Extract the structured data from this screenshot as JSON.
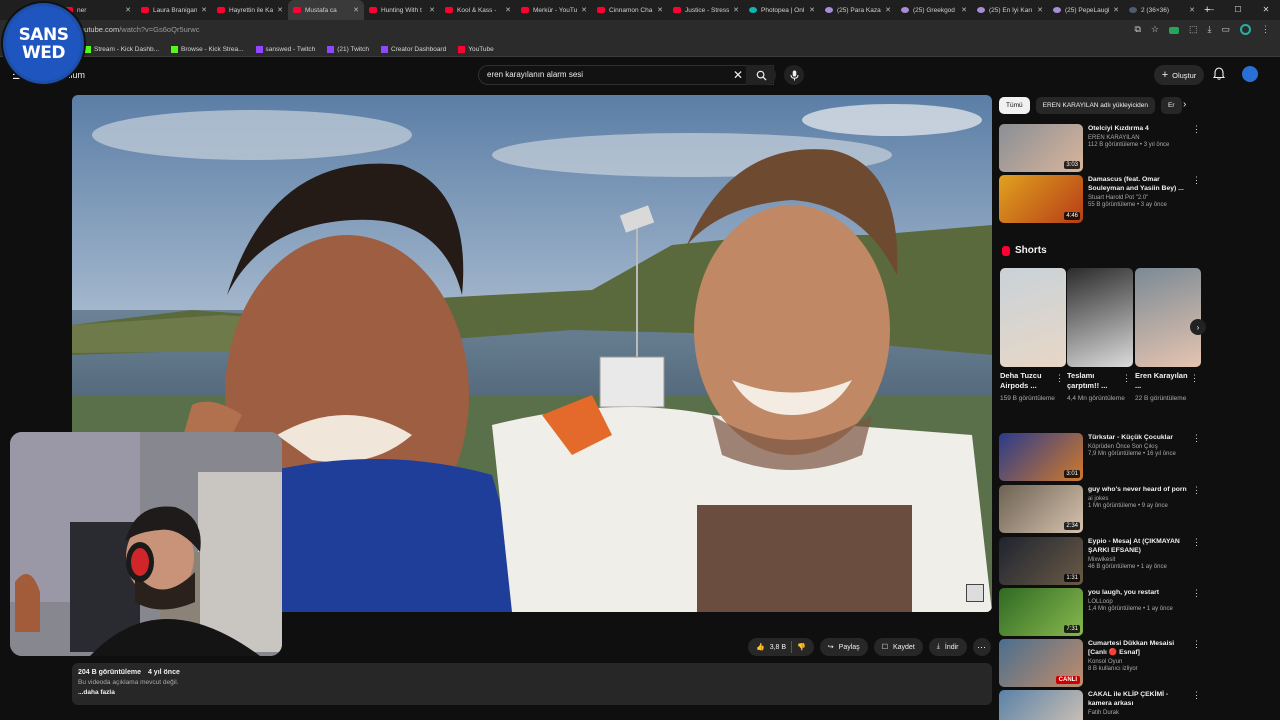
{
  "browser": {
    "tabs": [
      {
        "label": "ner",
        "favicon": "youtube"
      },
      {
        "label": "Laura Branigan",
        "favicon": "youtube"
      },
      {
        "label": "Hayrettin ile Ka",
        "favicon": "youtube"
      },
      {
        "label": "Mustafa ca",
        "favicon": "youtube",
        "active": true
      },
      {
        "label": "Hunting With t",
        "favicon": "youtube"
      },
      {
        "label": "Kool & Kass -",
        "favicon": "youtube"
      },
      {
        "label": "Merkür - YouTu",
        "favicon": "youtube"
      },
      {
        "label": "Cinnamon Cha",
        "favicon": "youtube"
      },
      {
        "label": "Justice - Stress",
        "favicon": "youtube"
      },
      {
        "label": "Photopea | Onl",
        "favicon": "photopea"
      },
      {
        "label": "(25) Para Kazan",
        "favicon": "meme"
      },
      {
        "label": "(25) Greekgod",
        "favicon": "meme"
      },
      {
        "label": "(25) En İyi Karı",
        "favicon": "meme"
      },
      {
        "label": "(25) PepeLaugh",
        "favicon": "meme"
      },
      {
        "label": "2 (36×36)",
        "favicon": "sphere"
      }
    ],
    "new_tab": "+",
    "url_host": "outube.com",
    "url_path": "/watch?v=Gs6oQr5urwc",
    "bookmarks": [
      {
        "label": "Stream - Kick Dashb...",
        "icon": "kick-icon"
      },
      {
        "label": "Browse - Kick Strea...",
        "icon": "kick-icon"
      },
      {
        "label": "sanswed - Twitch",
        "icon": "twitch-icon"
      },
      {
        "label": "(21) Twitch",
        "icon": "twitch-icon"
      },
      {
        "label": "Creator Dashboard",
        "icon": "twitch-icon"
      },
      {
        "label": "YouTube",
        "icon": "youtube-icon"
      }
    ]
  },
  "youtube": {
    "logo_suffix": "emium",
    "search_value": "eren karayılanın alarm sesi",
    "create_label": "Oluştur",
    "colors": {
      "brand_red": "#ff0033",
      "chip_active_bg": "#f1f1f1",
      "badge_blue": "#1e55bf"
    }
  },
  "badge": {
    "line1": "SANS",
    "line2": "WED"
  },
  "video": {
    "likes": "3,8 B",
    "share_label": "Paylaş",
    "save_label": "Kaydet",
    "download_label": "İndir",
    "views": "204 B görüntüleme",
    "age": "4 yıl önce",
    "no_description": "Bu videoda açıklama mevcut değil.",
    "more_label": "...daha fazla"
  },
  "sidebar": {
    "chips": [
      {
        "label": "Tümü",
        "active": true
      },
      {
        "label": "EREN KARAYILAN adlı yükleyiciden",
        "active": false
      },
      {
        "label": "Er",
        "active": false
      }
    ],
    "recs_top": [
      {
        "title": "Otelciyi Kızdırma 4",
        "channel": "EREN KARAYILAN",
        "meta": "112 B görüntüleme • 3 yıl önce",
        "duration": "3:03"
      },
      {
        "title": "Damascus (feat. Omar Souleyman and Yasiin Bey) ...",
        "channel": "Stuart Harold Pot \"2.0\"",
        "meta": "55 B görüntüleme • 3 ay önce",
        "duration": "4:46"
      }
    ],
    "shorts_title": "Shorts",
    "shorts": [
      {
        "title": "Deha Tuzcu Airpods ...",
        "views": "159 B görüntüleme"
      },
      {
        "title": "Teslamı çarptım!! ...",
        "views": "4,4 Mn görüntüleme"
      },
      {
        "title": "Eren Karayılan ...",
        "views": "22 B görüntüleme"
      }
    ],
    "recs_bottom": [
      {
        "title": "Türkstar - Küçük Çocuklar",
        "channel": "Köprüden Önce Son Çıkış",
        "meta": "7,9 Mn görüntüleme • 16 yıl önce",
        "duration": "3:01"
      },
      {
        "title": "guy who's never heard of porn",
        "channel": "ai jokes",
        "meta": "1 Mn görüntüleme • 9 ay önce",
        "duration": "2:34"
      },
      {
        "title": "Eypio - Mesaj At (ÇIKMAYAN ŞARKI EFSANE)",
        "channel": "Mixwikesit",
        "meta": "46 B görüntüleme • 1 ay önce",
        "duration": "1:31"
      },
      {
        "title": "you laugh, you restart",
        "channel": "LOLLoop",
        "meta": "1,4 Mn görüntüleme • 1 ay önce",
        "duration": "7:31"
      },
      {
        "title": "Cumartesi Dükkan Mesaisi [Canlı 🔴 Esnaf]",
        "channel": "Konsol Oyun",
        "meta": "8 B kullanıcı izliyor",
        "duration": "CANLI"
      },
      {
        "title": "CAKAL ile KLİP ÇEKİMİ - kamera arkası",
        "channel": "Fatih Durak",
        "meta": "",
        "duration": ""
      }
    ]
  }
}
